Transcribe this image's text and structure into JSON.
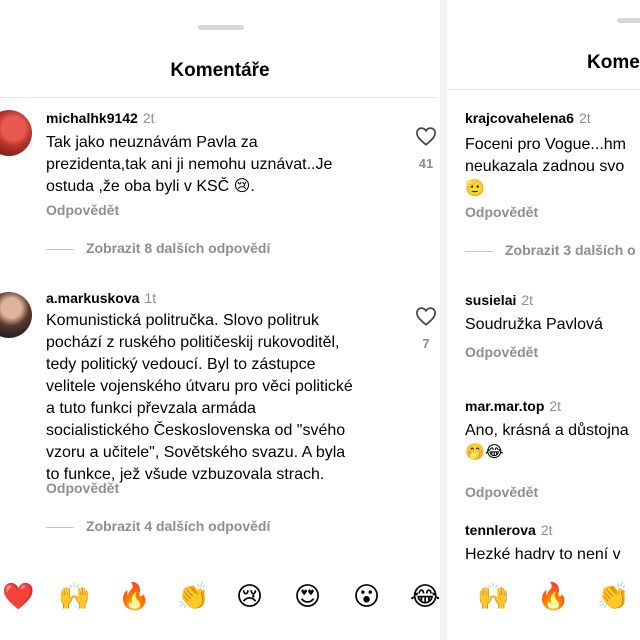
{
  "left": {
    "title": "Komentáře",
    "comments": [
      {
        "username": "michalhk9142",
        "time": "2t",
        "text": "Tak jako neuznávám Pavla za\nprezidenta,tak ani ji nemohu uznávat..Je\nostuda ,že oba byli v KSČ 😢.",
        "reply_label": "Odpovědět",
        "more_replies": "Zobrazit 8 dalších odpovědí",
        "likes": "41"
      },
      {
        "username": "a.markuskova",
        "time": "1t",
        "text": "Komunistická politručka. Slovo politruk\npochází z ruského političeskij rukovoditěl,\ntedy politický vedoucí. Byl to zástupce\nvelitele vojenského útvaru pro věci politické\na tuto funkci převzala armáda\nsocialistického Československa od \"svého\nvzoru a učitele\", Sovětského svazu. A byla\nto funkce, jež všude vzbuzovala strach.",
        "reply_label": "Odpovědět",
        "more_replies": "Zobrazit 4 dalších odpovědí",
        "likes": "7"
      }
    ],
    "emojis": [
      "❤️",
      "🙌",
      "🔥",
      "👏",
      "😢",
      "😍",
      "😮",
      "😂"
    ]
  },
  "right": {
    "title": "Kome",
    "comments": [
      {
        "username": "krajcovahelena6",
        "time": "2t",
        "text": "Foceni pro Vogue...hm\nneukazala zadnou svo\n🫡",
        "reply_label": "Odpovědět",
        "more_replies": "Zobrazit 3 dalších o"
      },
      {
        "username": "susielai",
        "time": "2t",
        "text": "Soudružka Pavlová",
        "reply_label": "Odpovědět"
      },
      {
        "username": "mar.mar.top",
        "time": "2t",
        "text": "Ano, krásná a důstojna\n🤭😂",
        "reply_label": "Odpovědět"
      },
      {
        "username": "tennlerova",
        "time": "2t",
        "text": "Hezké hadry to není v"
      }
    ],
    "emojis": [
      "🙌",
      "🔥",
      "👏"
    ]
  }
}
